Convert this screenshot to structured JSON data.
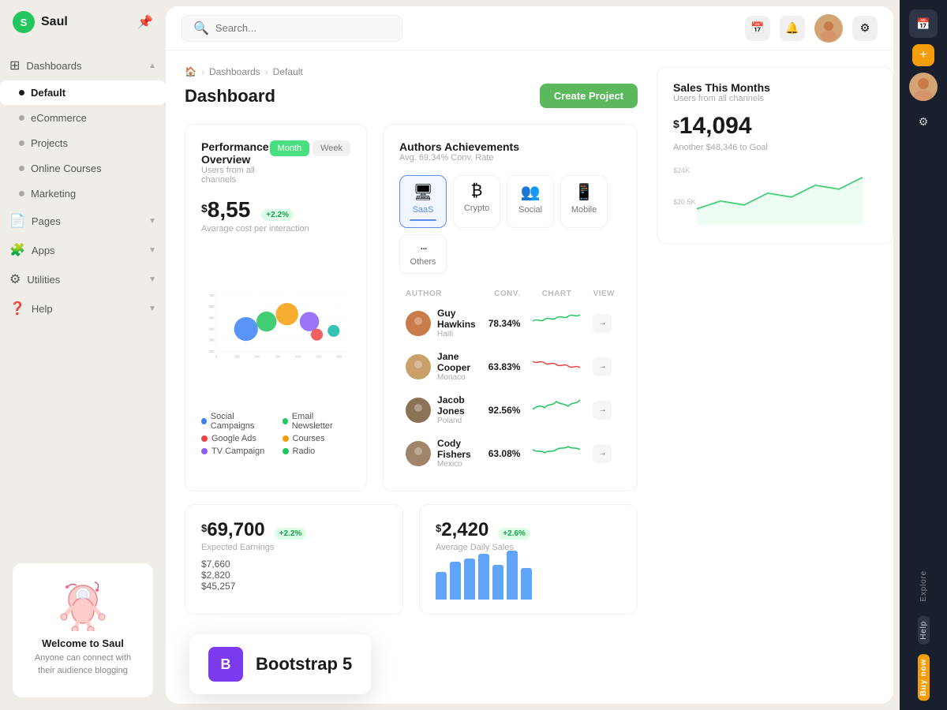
{
  "app": {
    "name": "Saul",
    "logo_letter": "S"
  },
  "sidebar": {
    "items": [
      {
        "id": "dashboards",
        "label": "Dashboards",
        "icon": "⊞",
        "has_chevron": true,
        "active": false,
        "type": "icon"
      },
      {
        "id": "default",
        "label": "Default",
        "active": true,
        "type": "dot"
      },
      {
        "id": "ecommerce",
        "label": "eCommerce",
        "active": false,
        "type": "dot"
      },
      {
        "id": "projects",
        "label": "Projects",
        "active": false,
        "type": "dot"
      },
      {
        "id": "online-courses",
        "label": "Online Courses",
        "active": false,
        "type": "dot"
      },
      {
        "id": "marketing",
        "label": "Marketing",
        "active": false,
        "type": "dot"
      },
      {
        "id": "pages",
        "label": "Pages",
        "icon": "📄",
        "has_chevron": true,
        "type": "icon"
      },
      {
        "id": "apps",
        "label": "Apps",
        "icon": "🧩",
        "has_chevron": true,
        "type": "icon"
      },
      {
        "id": "utilities",
        "label": "Utilities",
        "icon": "⚙",
        "has_chevron": true,
        "type": "icon"
      },
      {
        "id": "help",
        "label": "Help",
        "icon": "❓",
        "has_chevron": true,
        "type": "icon"
      }
    ],
    "welcome": {
      "title": "Welcome to Saul",
      "subtitle": "Anyone can connect with their audience blogging"
    }
  },
  "topbar": {
    "search_placeholder": "Search...",
    "search_label": "Search _"
  },
  "breadcrumb": {
    "home": "🏠",
    "section": "Dashboards",
    "page": "Default"
  },
  "page_title": "Dashboard",
  "create_button": "Create Project",
  "performance": {
    "title": "Performance Overview",
    "subtitle": "Users from all channels",
    "tabs": [
      "Month",
      "Week"
    ],
    "active_tab": "Month",
    "metric": "8,55",
    "metric_currency": "$",
    "metric_change": "+2.2%",
    "metric_label": "Avarage cost per interaction",
    "chart_y_labels": [
      "700",
      "600",
      "500",
      "400",
      "300",
      "200",
      "100",
      "0"
    ],
    "chart_x_labels": [
      "0",
      "100",
      "200",
      "300",
      "400",
      "500",
      "600",
      "700"
    ],
    "bubbles": [
      {
        "x": 22,
        "y": 45,
        "size": 65,
        "color": "#3b82f6",
        "label": "Social Campaigns"
      },
      {
        "x": 35,
        "y": 38,
        "size": 55,
        "color": "#22c55e",
        "label": "Email Newsletter"
      },
      {
        "x": 50,
        "y": 28,
        "size": 60,
        "color": "#f59e0b",
        "label": "Courses"
      },
      {
        "x": 62,
        "y": 38,
        "size": 50,
        "color": "#8b5cf6",
        "label": "TV Campaign"
      },
      {
        "x": 68,
        "y": 55,
        "size": 30,
        "color": "#ef4444",
        "label": "Google Ads"
      },
      {
        "x": 78,
        "y": 50,
        "size": 30,
        "color": "#14b8a6",
        "label": "Radio"
      }
    ],
    "legend": [
      {
        "label": "Social Campaigns",
        "color": "#3b82f6"
      },
      {
        "label": "Email Newsletter",
        "color": "#22c55e"
      },
      {
        "label": "Google Ads",
        "color": "#ef4444"
      },
      {
        "label": "Courses",
        "color": "#f59e0b"
      },
      {
        "label": "TV Campaign",
        "color": "#8b5cf6"
      },
      {
        "label": "Radio",
        "color": "#22c55e"
      }
    ]
  },
  "authors": {
    "title": "Authors Achievements",
    "subtitle": "Avg. 69.34% Conv. Rate",
    "categories": [
      {
        "id": "saas",
        "label": "SaaS",
        "icon": "🖥",
        "active": true
      },
      {
        "id": "crypto",
        "label": "Crypto",
        "icon": "₿",
        "active": false
      },
      {
        "id": "social",
        "label": "Social",
        "icon": "👥",
        "active": false
      },
      {
        "id": "mobile",
        "label": "Mobile",
        "icon": "📱",
        "active": false
      },
      {
        "id": "others",
        "label": "Others",
        "icon": "⋯",
        "active": false
      }
    ],
    "columns": {
      "author": "AUTHOR",
      "conv": "CONV.",
      "chart": "CHART",
      "view": "VIEW"
    },
    "rows": [
      {
        "name": "Guy Hawkins",
        "country": "Haiti",
        "conv": "78.34%",
        "chart_color": "#22c55e",
        "avatar_bg": "#c97c4a"
      },
      {
        "name": "Jane Cooper",
        "country": "Monaco",
        "conv": "63.83%",
        "chart_color": "#ef4444",
        "avatar_bg": "#c9a06a"
      },
      {
        "name": "Jacob Jones",
        "country": "Poland",
        "conv": "92.56%",
        "chart_color": "#22c55e",
        "avatar_bg": "#8b7355"
      },
      {
        "name": "Cody Fishers",
        "country": "Mexico",
        "conv": "63.08%",
        "chart_color": "#22c55e",
        "avatar_bg": "#a0856a"
      }
    ]
  },
  "stats": {
    "earnings": {
      "value": "69,700",
      "currency": "$",
      "change": "+2.2%",
      "label": "Expected Earnings",
      "amounts": [
        "$7,660",
        "$2,820",
        "$45,257"
      ]
    },
    "daily_sales": {
      "value": "2,420",
      "currency": "$",
      "change": "+2.6%",
      "label": "Average Daily Sales",
      "bars": [
        40,
        55,
        60,
        65,
        50,
        70,
        45
      ]
    }
  },
  "sales": {
    "title": "Sales This Months",
    "subtitle": "Users from all channels",
    "value": "14,094",
    "currency": "$",
    "goal_text": "Another $48,346 to Goal",
    "y_labels": [
      "$24K",
      "$20.5K"
    ]
  },
  "right_panel": {
    "icons": [
      "📅",
      "🔔",
      "💻",
      "⚙"
    ],
    "vertical_labels": [
      "Explore",
      "Help",
      "Buy now"
    ]
  },
  "bootstrap_badge": {
    "icon_letter": "B",
    "text": "Bootstrap 5"
  }
}
